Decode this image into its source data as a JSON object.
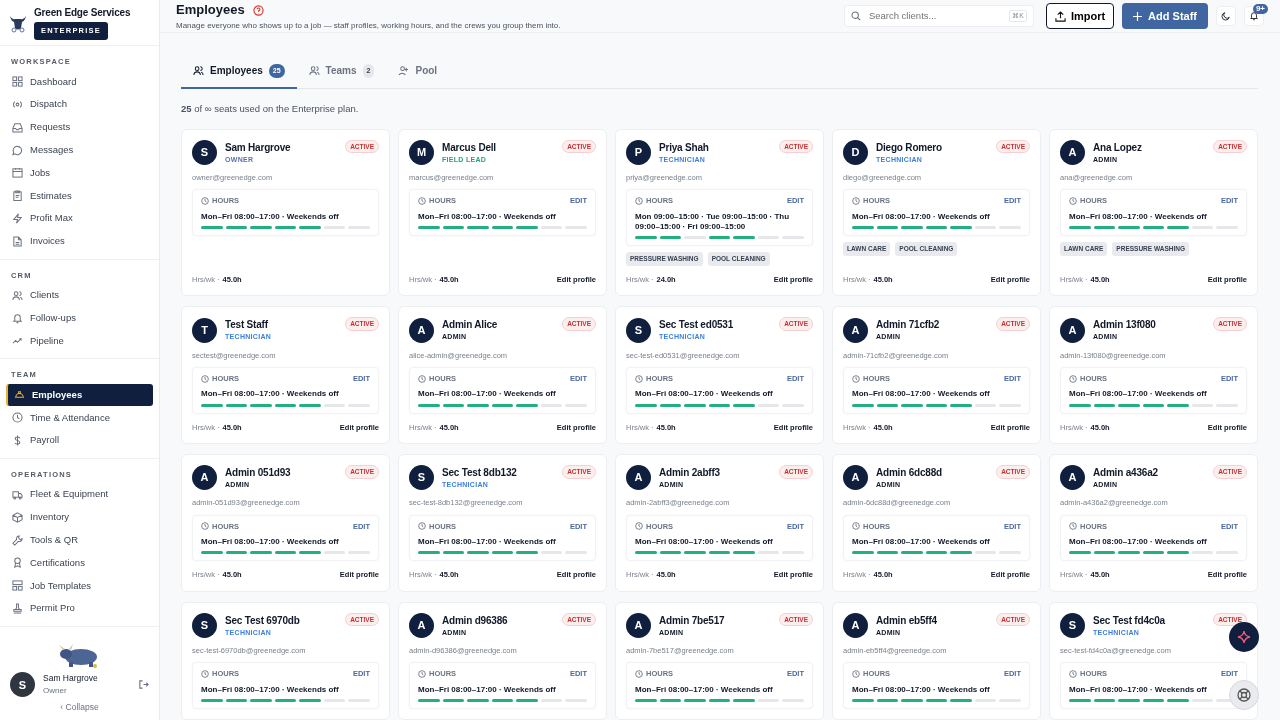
{
  "brand": {
    "name": "Green Edge Services",
    "plan": "ENTERPRISE"
  },
  "sidebar": {
    "sections": [
      {
        "title": "WORKSPACE",
        "items": [
          {
            "label": "Dashboard",
            "selected": false
          },
          {
            "label": "Dispatch",
            "selected": false
          },
          {
            "label": "Requests",
            "selected": false
          },
          {
            "label": "Messages",
            "selected": false
          },
          {
            "label": "Jobs",
            "selected": false
          },
          {
            "label": "Estimates",
            "selected": false
          },
          {
            "label": "Profit Max",
            "selected": false
          },
          {
            "label": "Invoices",
            "selected": false
          }
        ]
      },
      {
        "title": "CRM",
        "items": [
          {
            "label": "Clients",
            "selected": false
          },
          {
            "label": "Follow-ups",
            "selected": false
          },
          {
            "label": "Pipeline",
            "selected": false
          }
        ]
      },
      {
        "title": "TEAM",
        "items": [
          {
            "label": "Employees",
            "selected": true
          },
          {
            "label": "Time & Attendance",
            "selected": false
          },
          {
            "label": "Payroll",
            "selected": false
          }
        ]
      },
      {
        "title": "OPERATIONS",
        "items": [
          {
            "label": "Fleet & Equipment",
            "selected": false
          },
          {
            "label": "Inventory",
            "selected": false
          },
          {
            "label": "Tools & QR",
            "selected": false
          },
          {
            "label": "Certifications",
            "selected": false
          },
          {
            "label": "Job Templates",
            "selected": false
          },
          {
            "label": "Permit Pro",
            "selected": false
          }
        ]
      }
    ],
    "user": {
      "initial": "S",
      "name": "Sam Hargrove",
      "role": "Owner"
    },
    "collapse": "‹ Collapse"
  },
  "header": {
    "title": "Employees",
    "subtitle": "Manage everyone who shows up to a job — staff profiles, working hours, and the crews you group them into.",
    "search": {
      "placeholder": "Search clients...",
      "shortcut": "⌘K"
    },
    "import": "Import",
    "add": "Add Staff",
    "notifications": "9+"
  },
  "tabs": [
    {
      "label": "Employees",
      "count": "25",
      "selected": true
    },
    {
      "label": "Teams",
      "count": "2",
      "selected": false
    },
    {
      "label": "Pool",
      "selected": false
    }
  ],
  "seats": "**25** of ∞ seats used on the Enterprise plan.",
  "cards": [
    {
      "initial": "S",
      "name": "Sam Hargrove",
      "role": "OWNER",
      "color": "#5b73a8",
      "status": "ACTIVE",
      "email": "owner@greenedge.com",
      "hours_label": "HOURS",
      "hours": "Mon–Fri 08:00–17:00 · Weekends off",
      "days": [
        {
          "on": true
        },
        {
          "on": true
        },
        {
          "on": true
        },
        {
          "on": true
        },
        {
          "on": true
        },
        {
          "on": false
        },
        {
          "on": false
        }
      ],
      "hrs_label": "Hrs/wk ·",
      "hrs": "45.0h"
    },
    {
      "initial": "M",
      "name": "Marcus Dell",
      "role": "FIELD LEAD",
      "color": "#1fa67a",
      "status": "ACTIVE",
      "email": "marcus@greenedge.com",
      "hours_label": "HOURS",
      "edit": "EDIT",
      "hours": "Mon–Fri 08:00–17:00 · Weekends off",
      "days": [
        {
          "on": true
        },
        {
          "on": true
        },
        {
          "on": true
        },
        {
          "on": true
        },
        {
          "on": true
        },
        {
          "on": false
        },
        {
          "on": false
        }
      ],
      "hrs_label": "Hrs/wk ·",
      "hrs": "45.0h",
      "profile": "Edit profile"
    },
    {
      "initial": "P",
      "name": "Priya Shah",
      "role": "TECHNICIAN",
      "color": "#3b7fe0",
      "status": "ACTIVE",
      "email": "priya@greenedge.com",
      "hours_label": "HOURS",
      "edit": "EDIT",
      "hours": "Mon 09:00–15:00 · Tue 09:00–15:00 · Thu 09:00–15:00 · Fri 09:00–15:00",
      "days": [
        {
          "on": true
        },
        {
          "on": true
        },
        {
          "on": false
        },
        {
          "on": true
        },
        {
          "on": true
        },
        {
          "on": false
        },
        {
          "on": false
        }
      ],
      "tags": [
        "PRESSURE WASHING",
        "POOL CLEANING"
      ],
      "hrs_label": "Hrs/wk ·",
      "hrs": "24.0h",
      "profile": "Edit profile"
    },
    {
      "initial": "D",
      "name": "Diego Romero",
      "role": "TECHNICIAN",
      "color": "#3b7fe0",
      "status": "ACTIVE",
      "email": "diego@greenedge.com",
      "hours_label": "HOURS",
      "edit": "EDIT",
      "hours": "Mon–Fri 08:00–17:00 · Weekends off",
      "days": [
        {
          "on": true
        },
        {
          "on": true
        },
        {
          "on": true
        },
        {
          "on": true
        },
        {
          "on": true
        },
        {
          "on": false
        },
        {
          "on": false
        }
      ],
      "tags": [
        "LAWN CARE",
        "POOL CLEANING"
      ],
      "hrs_label": "Hrs/wk ·",
      "hrs": "45.0h",
      "profile": "Edit profile"
    },
    {
      "initial": "A",
      "name": "Ana Lopez",
      "role": "ADMIN",
      "color": "#111827",
      "status": "ACTIVE",
      "email": "ana@greenedge.com",
      "hours_label": "HOURS",
      "edit": "EDIT",
      "hours": "Mon–Fri 08:00–17:00 · Weekends off",
      "days": [
        {
          "on": true
        },
        {
          "on": true
        },
        {
          "on": true
        },
        {
          "on": true
        },
        {
          "on": true
        },
        {
          "on": false
        },
        {
          "on": false
        }
      ],
      "tags": [
        "LAWN CARE",
        "PRESSURE WASHING"
      ],
      "hrs_label": "Hrs/wk ·",
      "hrs": "45.0h",
      "profile": "Edit profile"
    },
    {
      "initial": "T",
      "name": "Test Staff",
      "role": "TECHNICIAN",
      "color": "#3b7fe0",
      "status": "ACTIVE",
      "email": "sectest@greenedge.com",
      "hours_label": "HOURS",
      "edit": "EDIT",
      "hours": "Mon–Fri 08:00–17:00 · Weekends off",
      "days": [
        {
          "on": true
        },
        {
          "on": true
        },
        {
          "on": true
        },
        {
          "on": true
        },
        {
          "on": true
        },
        {
          "on": false
        },
        {
          "on": false
        }
      ],
      "hrs_label": "Hrs/wk ·",
      "hrs": "45.0h",
      "profile": "Edit profile"
    },
    {
      "initial": "A",
      "name": "Admin Alice",
      "role": "ADMIN",
      "color": "#111827",
      "status": "ACTIVE",
      "email": "alice-admin@greenedge.com",
      "hours_label": "HOURS",
      "edit": "EDIT",
      "hours": "Mon–Fri 08:00–17:00 · Weekends off",
      "days": [
        {
          "on": true
        },
        {
          "on": true
        },
        {
          "on": true
        },
        {
          "on": true
        },
        {
          "on": true
        },
        {
          "on": false
        },
        {
          "on": false
        }
      ],
      "hrs_label": "Hrs/wk ·",
      "hrs": "45.0h",
      "profile": "Edit profile"
    },
    {
      "initial": "S",
      "name": "Sec Test ed0531",
      "role": "TECHNICIAN",
      "color": "#3b7fe0",
      "status": "ACTIVE",
      "email": "sec-test-ed0531@greenedge.com",
      "hours_label": "HOURS",
      "edit": "EDIT",
      "hours": "Mon–Fri 08:00–17:00 · Weekends off",
      "days": [
        {
          "on": true
        },
        {
          "on": true
        },
        {
          "on": true
        },
        {
          "on": true
        },
        {
          "on": true
        },
        {
          "on": false
        },
        {
          "on": false
        }
      ],
      "hrs_label": "Hrs/wk ·",
      "hrs": "45.0h",
      "profile": "Edit profile"
    },
    {
      "initial": "A",
      "name": "Admin 71cfb2",
      "role": "ADMIN",
      "color": "#111827",
      "status": "ACTIVE",
      "email": "admin-71cfb2@greenedge.com",
      "hours_label": "HOURS",
      "edit": "EDIT",
      "hours": "Mon–Fri 08:00–17:00 · Weekends off",
      "days": [
        {
          "on": true
        },
        {
          "on": true
        },
        {
          "on": true
        },
        {
          "on": true
        },
        {
          "on": true
        },
        {
          "on": false
        },
        {
          "on": false
        }
      ],
      "hrs_label": "Hrs/wk ·",
      "hrs": "45.0h",
      "profile": "Edit profile"
    },
    {
      "initial": "A",
      "name": "Admin 13f080",
      "role": "ADMIN",
      "color": "#111827",
      "status": "ACTIVE",
      "email": "admin-13f080@greenedge.com",
      "hours_label": "HOURS",
      "edit": "EDIT",
      "hours": "Mon–Fri 08:00–17:00 · Weekends off",
      "days": [
        {
          "on": true
        },
        {
          "on": true
        },
        {
          "on": true
        },
        {
          "on": true
        },
        {
          "on": true
        },
        {
          "on": false
        },
        {
          "on": false
        }
      ],
      "hrs_label": "Hrs/wk ·",
      "hrs": "45.0h",
      "profile": "Edit profile"
    },
    {
      "initial": "A",
      "name": "Admin 051d93",
      "role": "ADMIN",
      "color": "#111827",
      "status": "ACTIVE",
      "email": "admin-051d93@greenedge.com",
      "hours_label": "HOURS",
      "edit": "EDIT",
      "hours": "Mon–Fri 08:00–17:00 · Weekends off",
      "days": [
        {
          "on": true
        },
        {
          "on": true
        },
        {
          "on": true
        },
        {
          "on": true
        },
        {
          "on": true
        },
        {
          "on": false
        },
        {
          "on": false
        }
      ],
      "hrs_label": "Hrs/wk ·",
      "hrs": "45.0h",
      "profile": "Edit profile"
    },
    {
      "initial": "S",
      "name": "Sec Test 8db132",
      "role": "TECHNICIAN",
      "color": "#3b7fe0",
      "status": "ACTIVE",
      "email": "sec-test-8db132@greenedge.com",
      "hours_label": "HOURS",
      "edit": "EDIT",
      "hours": "Mon–Fri 08:00–17:00 · Weekends off",
      "days": [
        {
          "on": true
        },
        {
          "on": true
        },
        {
          "on": true
        },
        {
          "on": true
        },
        {
          "on": true
        },
        {
          "on": false
        },
        {
          "on": false
        }
      ],
      "hrs_label": "Hrs/wk ·",
      "hrs": "45.0h",
      "profile": "Edit profile"
    },
    {
      "initial": "A",
      "name": "Admin 2abff3",
      "role": "ADMIN",
      "color": "#111827",
      "status": "ACTIVE",
      "email": "admin-2abff3@greenedge.com",
      "hours_label": "HOURS",
      "edit": "EDIT",
      "hours": "Mon–Fri 08:00–17:00 · Weekends off",
      "days": [
        {
          "on": true
        },
        {
          "on": true
        },
        {
          "on": true
        },
        {
          "on": true
        },
        {
          "on": true
        },
        {
          "on": false
        },
        {
          "on": false
        }
      ],
      "hrs_label": "Hrs/wk ·",
      "hrs": "45.0h",
      "profile": "Edit profile"
    },
    {
      "initial": "A",
      "name": "Admin 6dc88d",
      "role": "ADMIN",
      "color": "#111827",
      "status": "ACTIVE",
      "email": "admin-6dc88d@greenedge.com",
      "hours_label": "HOURS",
      "edit": "EDIT",
      "hours": "Mon–Fri 08:00–17:00 · Weekends off",
      "days": [
        {
          "on": true
        },
        {
          "on": true
        },
        {
          "on": true
        },
        {
          "on": true
        },
        {
          "on": true
        },
        {
          "on": false
        },
        {
          "on": false
        }
      ],
      "hrs_label": "Hrs/wk ·",
      "hrs": "45.0h",
      "profile": "Edit profile"
    },
    {
      "initial": "A",
      "name": "Admin a436a2",
      "role": "ADMIN",
      "color": "#111827",
      "status": "ACTIVE",
      "email": "admin-a436a2@greenedge.com",
      "hours_label": "HOURS",
      "edit": "EDIT",
      "hours": "Mon–Fri 08:00–17:00 · Weekends off",
      "days": [
        {
          "on": true
        },
        {
          "on": true
        },
        {
          "on": true
        },
        {
          "on": true
        },
        {
          "on": true
        },
        {
          "on": false
        },
        {
          "on": false
        }
      ],
      "hrs_label": "Hrs/wk ·",
      "hrs": "45.0h",
      "profile": "Edit profile"
    },
    {
      "initial": "S",
      "name": "Sec Test 6970db",
      "role": "TECHNICIAN",
      "color": "#3b7fe0",
      "status": "ACTIVE",
      "email": "sec-test-6970db@greenedge.com",
      "hours_label": "HOURS",
      "edit": "EDIT",
      "hours": "Mon–Fri 08:00–17:00 · Weekends off",
      "days": [
        {
          "on": true
        },
        {
          "on": true
        },
        {
          "on": true
        },
        {
          "on": true
        },
        {
          "on": true
        },
        {
          "on": false
        },
        {
          "on": false
        }
      ]
    },
    {
      "initial": "A",
      "name": "Admin d96386",
      "role": "ADMIN",
      "color": "#111827",
      "status": "ACTIVE",
      "email": "admin-d96386@greenedge.com",
      "hours_label": "HOURS",
      "edit": "EDIT",
      "hours": "Mon–Fri 08:00–17:00 · Weekends off",
      "days": [
        {
          "on": true
        },
        {
          "on": true
        },
        {
          "on": true
        },
        {
          "on": true
        },
        {
          "on": true
        },
        {
          "on": false
        },
        {
          "on": false
        }
      ]
    },
    {
      "initial": "A",
      "name": "Admin 7be517",
      "role": "ADMIN",
      "color": "#111827",
      "status": "ACTIVE",
      "email": "admin-7be517@greenedge.com",
      "hours_label": "HOURS",
      "edit": "EDIT",
      "hours": "Mon–Fri 08:00–17:00 · Weekends off",
      "days": [
        {
          "on": true
        },
        {
          "on": true
        },
        {
          "on": true
        },
        {
          "on": true
        },
        {
          "on": true
        },
        {
          "on": false
        },
        {
          "on": false
        }
      ]
    },
    {
      "initial": "A",
      "name": "Admin eb5ff4",
      "role": "ADMIN",
      "color": "#111827",
      "status": "ACTIVE",
      "email": "admin-eb5ff4@greenedge.com",
      "hours_label": "HOURS",
      "edit": "EDIT",
      "hours": "Mon–Fri 08:00–17:00 · Weekends off",
      "days": [
        {
          "on": true
        },
        {
          "on": true
        },
        {
          "on": true
        },
        {
          "on": true
        },
        {
          "on": true
        },
        {
          "on": false
        },
        {
          "on": false
        }
      ]
    },
    {
      "initial": "S",
      "name": "Sec Test fd4c0a",
      "role": "TECHNICIAN",
      "color": "#3b7fe0",
      "status": "ACTIVE",
      "email": "sec-test-fd4c0a@greenedge.com",
      "hours_label": "HOURS",
      "edit": "EDIT",
      "hours": "Mon–Fri 08:00–17:00 · Weekends off",
      "days": [
        {
          "on": true
        },
        {
          "on": true
        },
        {
          "on": true
        },
        {
          "on": true
        },
        {
          "on": true
        },
        {
          "on": false
        },
        {
          "on": false
        }
      ]
    }
  ]
}
